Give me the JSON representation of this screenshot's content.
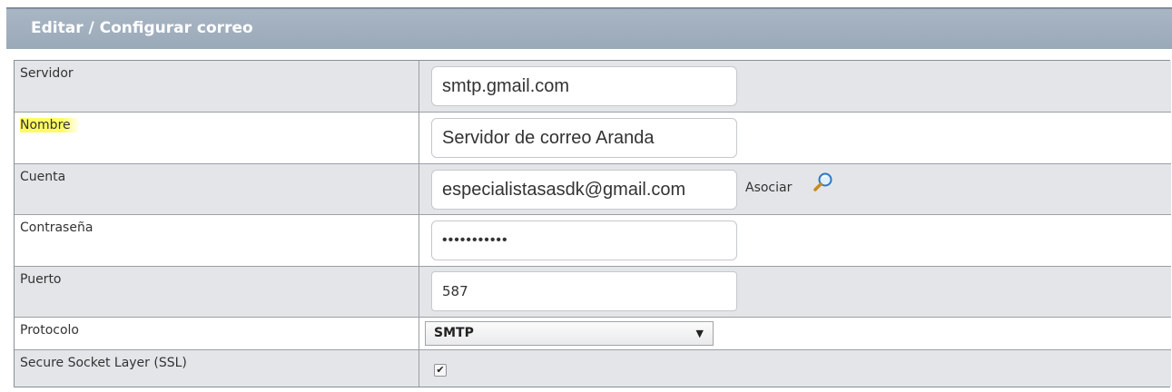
{
  "header": {
    "title": "Editar / Configurar correo"
  },
  "form": {
    "servidor": {
      "label": "Servidor",
      "value": "smtp.gmail.com"
    },
    "nombre": {
      "label": "Nombre",
      "value": "Servidor de correo Aranda"
    },
    "cuenta": {
      "label": "Cuenta",
      "value": "especialistasasdk@gmail.com",
      "associate_label": "Asociar"
    },
    "contrasena": {
      "label": "Contraseña",
      "value": "•••••••••••"
    },
    "puerto": {
      "label": "Puerto",
      "value": "587"
    },
    "protocolo": {
      "label": "Protocolo",
      "selected": "SMTP",
      "arrow": "▼"
    },
    "ssl": {
      "label": "Secure Socket Layer (SSL)",
      "checked": true,
      "check_mark": "✔"
    }
  },
  "colors": {
    "header_bg": "#9aa9b8",
    "row_gray": "#e3e5e8",
    "highlight": "#fffb63"
  }
}
